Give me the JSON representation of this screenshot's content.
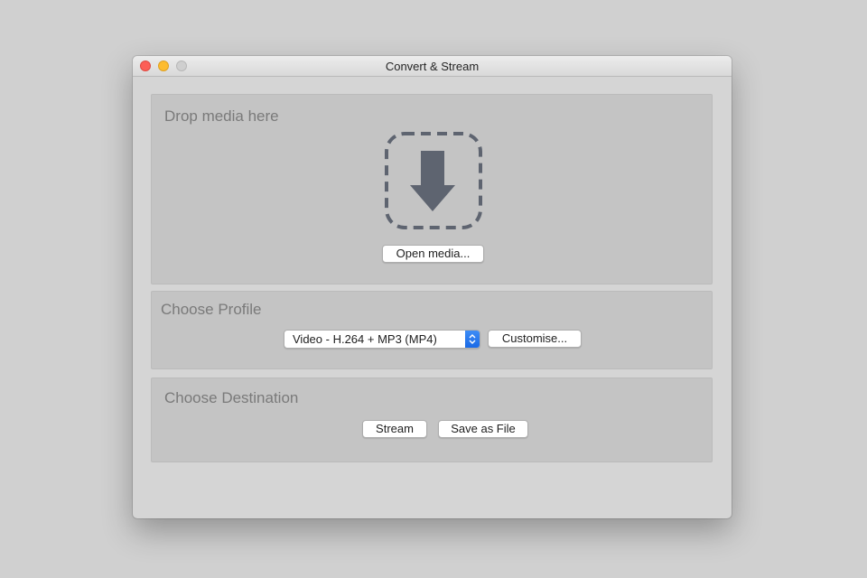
{
  "window": {
    "title": "Convert & Stream"
  },
  "drop": {
    "heading": "Drop media here",
    "open_button": "Open media..."
  },
  "profile": {
    "heading": "Choose Profile",
    "selected": "Video - H.264 + MP3 (MP4)",
    "customise_button": "Customise..."
  },
  "destination": {
    "heading": "Choose Destination",
    "stream_button": "Stream",
    "save_button": "Save as File"
  },
  "colors": {
    "close": "#fc5f57",
    "minimize": "#fdbc2e",
    "zoom_disabled": "#cfcfcf",
    "select_accent": "#1a6ae6",
    "drop_icon": "#5e6470"
  },
  "icons": {
    "drop_target": "download-arrow-icon",
    "select_arrow": "updown-chevron-icon"
  }
}
